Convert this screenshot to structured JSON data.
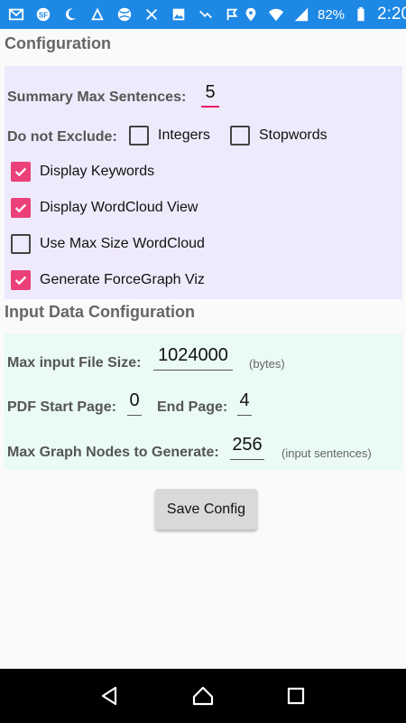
{
  "status_bar": {
    "battery_text": "82%",
    "time": "2:20",
    "left_icons": [
      "gmail-icon",
      "app-sf-icon",
      "moon-icon",
      "signal-notify-icon",
      "ball-icon",
      "app-x-icon",
      "image-icon",
      "trend-icon",
      "check-flag-icon"
    ],
    "right_icons": [
      "location-icon",
      "wifi-icon",
      "cell-signal-icon",
      "battery-icon"
    ]
  },
  "config": {
    "title": "Configuration",
    "summary_label": "Summary Max Sentences:",
    "summary_value": "5",
    "exclude_label": "Do not Exclude:",
    "integers_label": "Integers",
    "stopwords_label": "Stopwords",
    "display_keywords_label": "Display Keywords",
    "display_wordcloud_label": "Display WordCloud View",
    "use_max_size_label": "Use Max Size WordCloud",
    "generate_forcegraph_label": "Generate ForceGraph Viz"
  },
  "checkbox_states": {
    "integers": false,
    "stopwords": false,
    "display_keywords": true,
    "display_wordcloud": true,
    "use_max_size": false,
    "generate_forcegraph": true
  },
  "input_config": {
    "title": "Input Data Configuration",
    "max_file_label": "Max input File Size:",
    "max_file_value": "1024000",
    "max_file_hint": "(bytes)",
    "pdf_start_label": "PDF Start Page:",
    "pdf_start_value": "0",
    "end_page_label": "End Page:",
    "end_page_value": "4",
    "max_nodes_label": "Max Graph Nodes to Generate:",
    "max_nodes_value": "256",
    "max_nodes_hint": "(input sentences)"
  },
  "save_button": "Save Config",
  "colors": {
    "status_bar": "#1e88e5",
    "accent": "#ec407a",
    "panel_purple": "#eeeafc",
    "panel_mint": "#eafaf4"
  }
}
